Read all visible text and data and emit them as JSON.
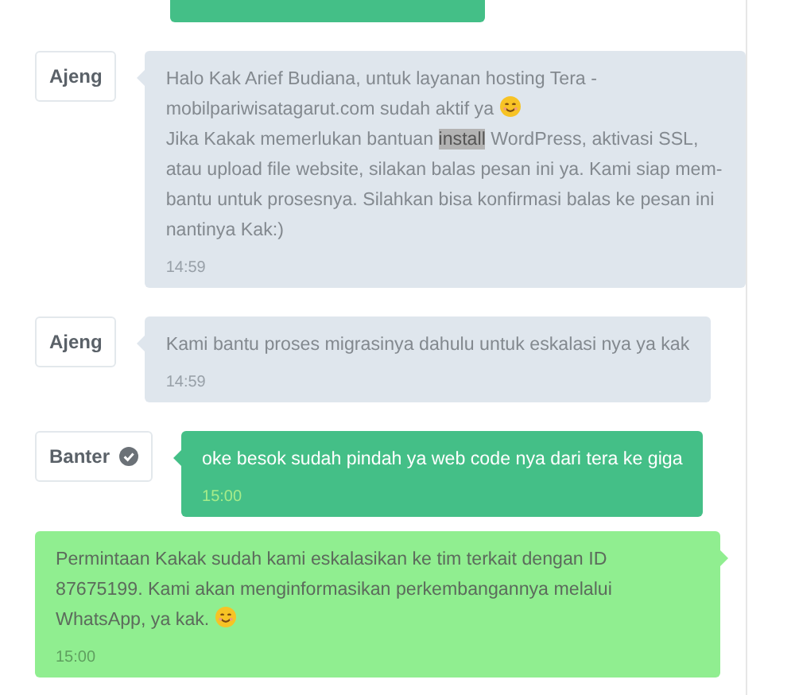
{
  "cut_bubble": {
    "kind": "outgoing"
  },
  "messages": [
    {
      "kind": "incoming",
      "sender": {
        "name": "Ajeng",
        "verified": false
      },
      "segments": [
        {
          "kind": "text",
          "text": "Halo Kak Arief Budiana, untuk layanan hosting Tera - mobilpariwisatagarut.com sudah aktif ya ",
          "highlighted": false
        },
        {
          "kind": "emoji"
        },
        {
          "kind": "text",
          "text": "\nJika Kakak memerlukan bantuan ",
          "highlighted": false
        },
        {
          "kind": "text",
          "text": "install",
          "highlighted": true
        },
        {
          "kind": "text",
          "text": " WordPress, aktivasi SSL, atau upload file website, silakan balas pesan ini ya. Kami siap mem-bantu untuk prosesnya. Silahkan bisa konfirmasi balas ke pesan ini nantinya Kak:)",
          "highlighted": false
        }
      ],
      "time": "14:59"
    },
    {
      "kind": "incoming",
      "sender": {
        "name": "Ajeng",
        "verified": false
      },
      "segments": [
        {
          "kind": "text",
          "text": "Kami bantu proses migrasinya dahulu untuk eskalasi nya ya kak",
          "highlighted": false
        }
      ],
      "time": "14:59"
    },
    {
      "kind": "outgoing",
      "sender": {
        "name": "Banter",
        "verified": true
      },
      "segments": [
        {
          "kind": "text",
          "text": "oke besok sudah pindah ya web code nya dari tera ke giga",
          "highlighted": false
        }
      ],
      "time": "15:00"
    },
    {
      "kind": "note",
      "segments": [
        {
          "kind": "text",
          "text": "Permintaan Kakak sudah kami eskalasikan ke tim terkait dengan ID 87675199. Kami akan menginformasikan perkembangannya melalui WhatsApp, ya kak. ",
          "highlighted": false
        },
        {
          "kind": "emoji"
        }
      ],
      "time": "15:00"
    }
  ]
}
